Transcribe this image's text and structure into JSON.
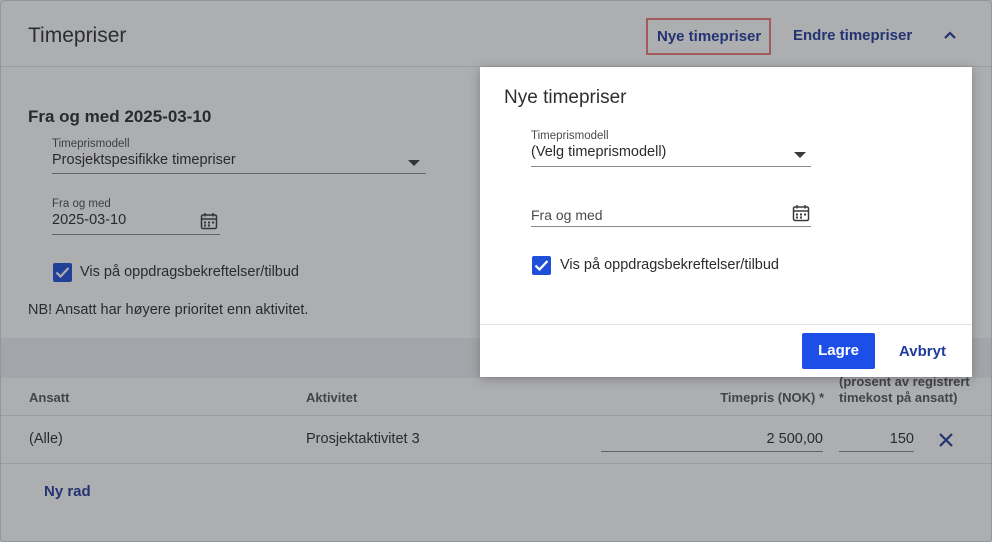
{
  "header": {
    "title": "Timepriser",
    "new_prices_label": "Nye timepriser",
    "edit_prices_label": "Endre timepriser"
  },
  "section": {
    "title": "Fra og med 2025-03-10",
    "model_label": "Timeprismodell",
    "model_value": "Prosjektspesifikke timepriser",
    "from_label": "Fra og med",
    "from_value": "2025-03-10",
    "show_on_label": "Vis på oppdragsbekreftelser/tilbud",
    "show_on_checked": true,
    "note": "NB! Ansatt har høyere prioritet enn aktivitet."
  },
  "table": {
    "headers": {
      "employee": "Ansatt",
      "activity": "Aktivitet",
      "rate": "Timepris (NOK) *",
      "percent_line1": "(prosent av registrert",
      "percent_line2": "timekost på ansatt)"
    },
    "rows": [
      {
        "employee": "(Alle)",
        "activity": "Prosjektaktivitet 3",
        "rate": "2 500,00",
        "percent": "150"
      }
    ],
    "add_row_label": "Ny rad"
  },
  "modal": {
    "title": "Nye timepriser",
    "model_label": "Timeprismodell",
    "model_value": "(Velg timeprismodell)",
    "from_placeholder": "Fra og med",
    "show_on_label": "Vis på oppdragsbekreftelser/tilbud",
    "show_on_checked": true,
    "save_label": "Lagre",
    "cancel_label": "Avbryt"
  },
  "colors": {
    "accent": "#1d4fe8",
    "link": "#1f3b9c",
    "highlight_border": "#f07a7a"
  },
  "icons": [
    "chevron-up-icon",
    "chevron-down-icon",
    "calendar-icon",
    "checkbox-checked-icon",
    "close-icon"
  ]
}
